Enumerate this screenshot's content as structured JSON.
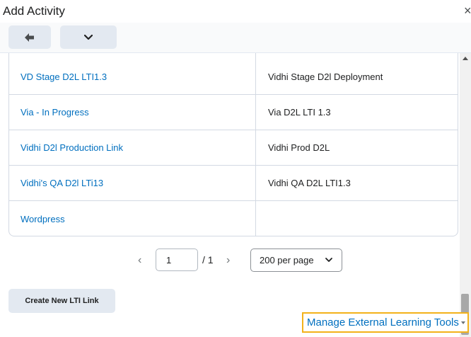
{
  "dialog": {
    "title": "Add Activity",
    "close_glyph": "×"
  },
  "toolbar": {
    "back_icon": "back-arrow-icon",
    "more_icon": "chevron-down-icon"
  },
  "table": {
    "rows": [
      {
        "name": "VD Stage D2L LTI1.3",
        "description": "Vidhi Stage D2l Deployment"
      },
      {
        "name": "Via - In Progress",
        "description": "Via D2L LTI 1.3"
      },
      {
        "name": "Vidhi D2l Production Link",
        "description": "Vidhi Prod D2L"
      },
      {
        "name": "Vidhi's QA D2l LTi13",
        "description": "Vidhi QA D2L LTI1.3"
      },
      {
        "name": "Wordpress",
        "description": ""
      }
    ]
  },
  "pagination": {
    "prev_glyph": "‹",
    "next_glyph": "›",
    "current_page": "1",
    "total_pages": "/ 1",
    "per_page": "200 per page"
  },
  "actions": {
    "create_lti_link": "Create New LTI Link",
    "manage_tools": "Manage External Learning Tools"
  },
  "colors": {
    "link": "#006fbf",
    "button_bg": "#e3e9f1",
    "highlight_border": "#f3b21a"
  }
}
